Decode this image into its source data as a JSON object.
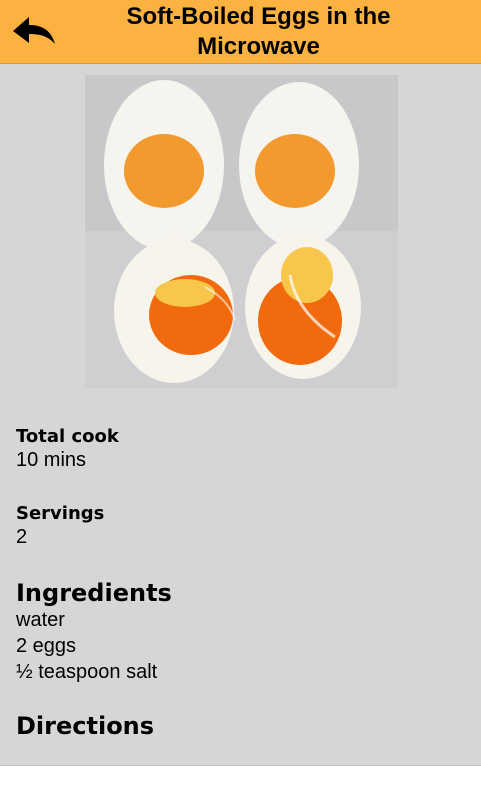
{
  "header": {
    "title": "Soft-Boiled Eggs in the Microwave",
    "back_icon": "back-arrow-icon",
    "background_color": "#fcb240"
  },
  "recipe": {
    "total_cook_label": "Total cook",
    "total_cook_value": "10 mins",
    "servings_label": "Servings",
    "servings_value": "2",
    "ingredients_heading": "Ingredients",
    "ingredients": [
      "water",
      "2 eggs",
      "½ teaspoon salt"
    ],
    "directions_heading": "Directions"
  },
  "colors": {
    "content_background": "#d6d6d6",
    "page_background": "#ffffff"
  }
}
